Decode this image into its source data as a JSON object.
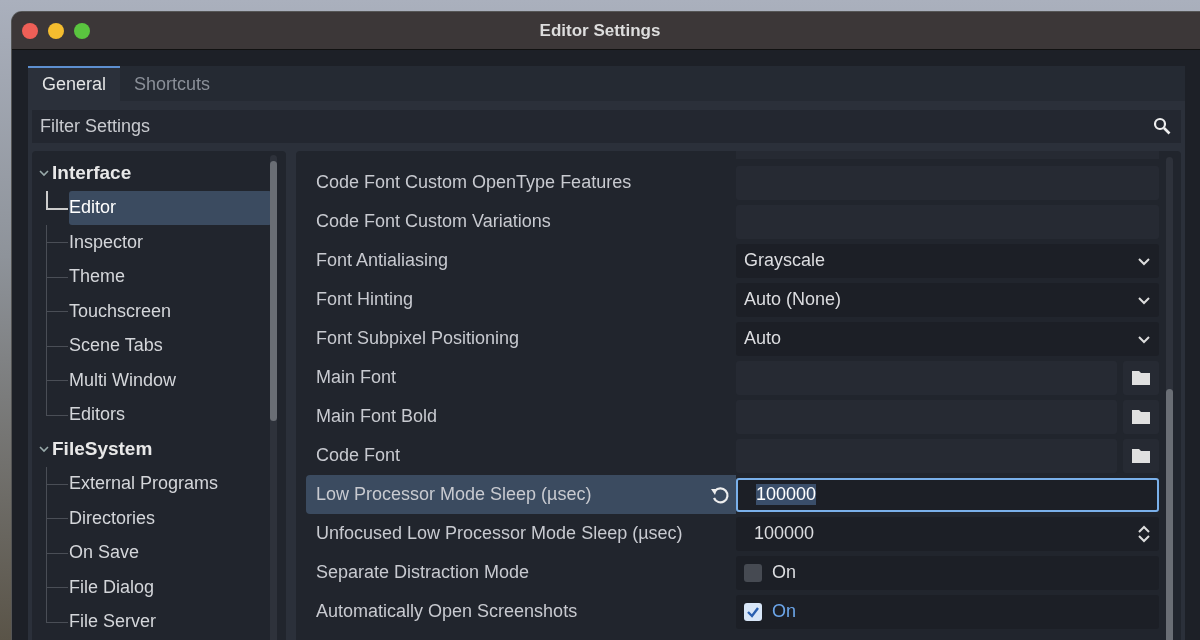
{
  "window": {
    "title": "Editor Settings"
  },
  "tabs": [
    {
      "label": "General",
      "selected": true
    },
    {
      "label": "Shortcuts",
      "selected": false
    }
  ],
  "filter": {
    "placeholder": "Filter Settings"
  },
  "tree": [
    {
      "label": "Interface",
      "expanded": true,
      "children": [
        {
          "label": "Editor",
          "selected": true
        },
        {
          "label": "Inspector",
          "selected": false
        },
        {
          "label": "Theme",
          "selected": false
        },
        {
          "label": "Touchscreen",
          "selected": false
        },
        {
          "label": "Scene Tabs",
          "selected": false
        },
        {
          "label": "Multi Window",
          "selected": false
        },
        {
          "label": "Editors",
          "selected": false
        }
      ]
    },
    {
      "label": "FileSystem",
      "expanded": true,
      "children": [
        {
          "label": "External Programs",
          "selected": false
        },
        {
          "label": "Directories",
          "selected": false
        },
        {
          "label": "On Save",
          "selected": false
        },
        {
          "label": "File Dialog",
          "selected": false
        },
        {
          "label": "File Server",
          "selected": false
        }
      ]
    }
  ],
  "settings": [
    {
      "kind": "text",
      "label": "Code Font Custom OpenType Features",
      "selected": false
    },
    {
      "kind": "text",
      "label": "Code Font Custom Variations",
      "selected": false
    },
    {
      "kind": "dropdown",
      "label": "Font Antialiasing",
      "value": "Grayscale",
      "selected": false
    },
    {
      "kind": "dropdown",
      "label": "Font Hinting",
      "value": "Auto (None)",
      "selected": false
    },
    {
      "kind": "dropdown",
      "label": "Font Subpixel Positioning",
      "value": "Auto",
      "selected": false
    },
    {
      "kind": "file",
      "label": "Main Font",
      "selected": false
    },
    {
      "kind": "file",
      "label": "Main Font Bold",
      "selected": false
    },
    {
      "kind": "file",
      "label": "Code Font",
      "selected": false
    },
    {
      "kind": "number",
      "label": "Low Processor Mode Sleep (µsec)",
      "value": "100000",
      "selected": true
    },
    {
      "kind": "spin",
      "label": "Unfocused Low Processor Mode Sleep (µsec)",
      "value": "100000",
      "selected": false
    },
    {
      "kind": "checkbox",
      "label": "Separate Distraction Mode",
      "value": "On",
      "checked": false,
      "selected": false
    },
    {
      "kind": "checkbox",
      "label": "Automatically Open Screenshots",
      "value": "On",
      "checked": true,
      "selected": false
    }
  ]
}
